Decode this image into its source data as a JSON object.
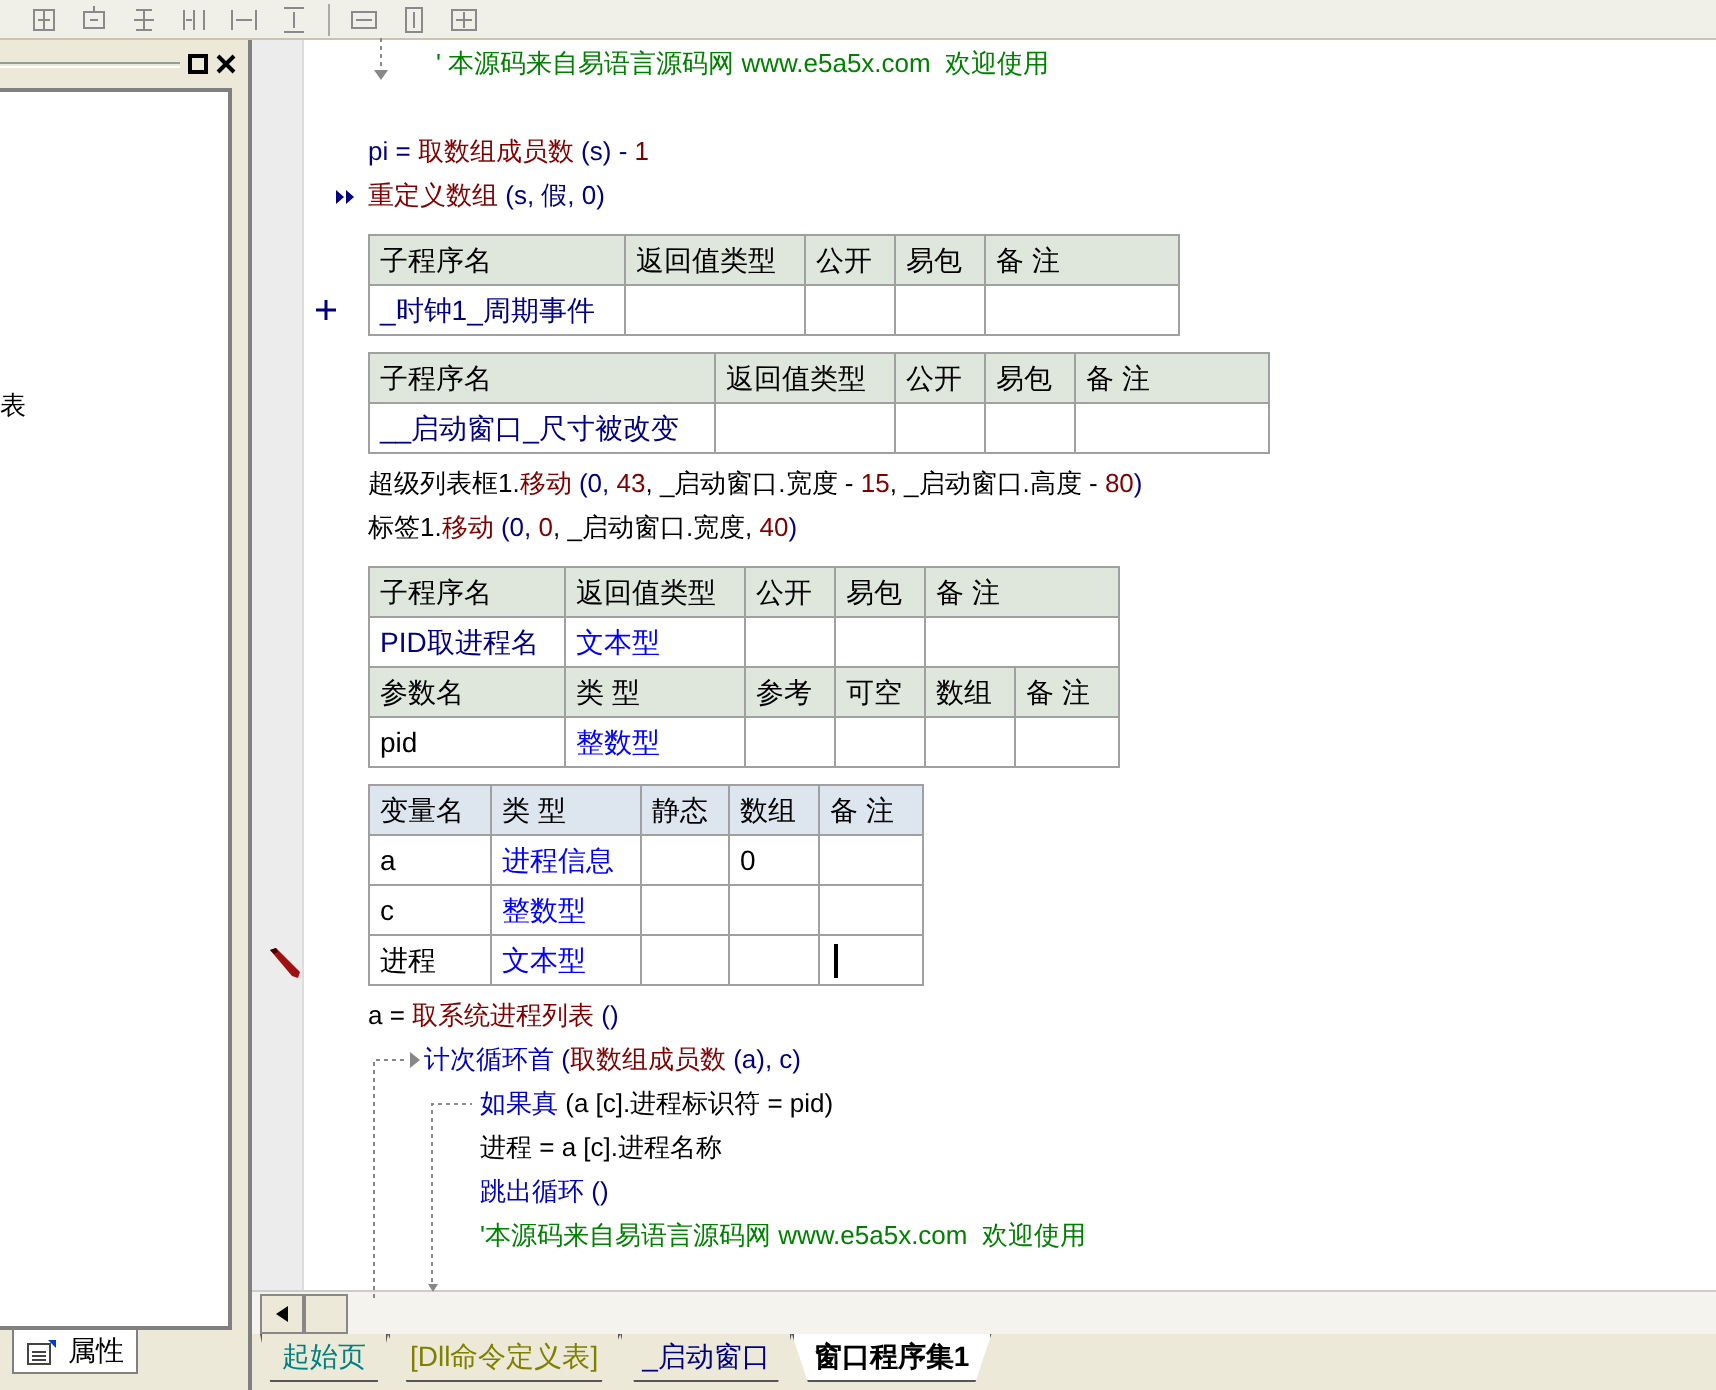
{
  "left_panel": {
    "items": [
      "表"
    ],
    "tabs": [
      {
        "label": "属性",
        "selected": true
      }
    ]
  },
  "code": [
    {
      "kind": "loop_end",
      "segments": [
        {
          "text": "' 本源码来自易语言源码网 www.e5a5x.com  欢迎使用",
          "color": "#008000"
        }
      ]
    },
    {
      "kind": "line",
      "segments": [
        {
          "text": "pi = ",
          "color": "#000080"
        },
        {
          "text": "取数组成员数",
          "color": "#800000"
        },
        {
          "text": " (s) - ",
          "color": "#000080"
        },
        {
          "text": "1",
          "color": "#800000"
        }
      ]
    },
    {
      "kind": "line",
      "marker": true,
      "segments": [
        {
          "text": "重定义数组",
          "color": "#800000"
        },
        {
          "text": " (s, 假, 0)",
          "color": "#000080"
        }
      ]
    },
    {
      "kind": "table",
      "expandable": true,
      "rows": [
        {
          "kind": "header",
          "cells": [
            {
              "text": "子程序名"
            },
            {
              "text": "返回值类型"
            },
            {
              "text": "公开"
            },
            {
              "text": "易包"
            },
            {
              "text": "备 注"
            }
          ]
        },
        {
          "kind": "row",
          "cells": [
            {
              "text": "_时钟1_周期事件",
              "color": "#000080"
            },
            {},
            {},
            {},
            {}
          ]
        }
      ]
    },
    {
      "kind": "table",
      "rows": [
        {
          "kind": "header",
          "cells": [
            {
              "text": "子程序名"
            },
            {
              "text": "返回值类型"
            },
            {
              "text": "公开"
            },
            {
              "text": "易包"
            },
            {
              "text": "备 注"
            }
          ]
        },
        {
          "kind": "row",
          "cells": [
            {
              "text": "__启动窗口_尺寸被改变",
              "color": "#000080"
            },
            {},
            {},
            {},
            {}
          ]
        }
      ]
    },
    {
      "kind": "line",
      "segments": [
        {
          "text": "超级列表框1.",
          "color": "#000000"
        },
        {
          "text": "移动",
          "color": "#800000"
        },
        {
          "text": " (0, ",
          "color": "#000080"
        },
        {
          "text": "43",
          "color": "#800000"
        },
        {
          "text": ", _启动窗口.宽度 - ",
          "color": "#000000"
        },
        {
          "text": "15",
          "color": "#800000"
        },
        {
          "text": ", _启动窗口.高度 - ",
          "color": "#000000"
        },
        {
          "text": "80",
          "color": "#800000"
        },
        {
          "text": ")",
          "color": "#000080"
        }
      ]
    },
    {
      "kind": "line",
      "segments": [
        {
          "text": "标签1.",
          "color": "#000000"
        },
        {
          "text": "移动",
          "color": "#800000"
        },
        {
          "text": " (0, ",
          "color": "#000080"
        },
        {
          "text": "0",
          "color": "#800000"
        },
        {
          "text": ", _启动窗口.宽度, ",
          "color": "#000000"
        },
        {
          "text": "40",
          "color": "#800000"
        },
        {
          "text": ")",
          "color": "#000080"
        }
      ]
    },
    {
      "kind": "table",
      "rows": [
        {
          "kind": "header",
          "cells": [
            {
              "text": "子程序名"
            },
            {
              "text": "返回值类型"
            },
            {
              "text": "公开"
            },
            {
              "text": "易包"
            },
            {
              "text": "备 注"
            }
          ]
        },
        {
          "kind": "row",
          "cells": [
            {
              "text": "PID取进程名",
              "color": "#000080"
            },
            {
              "text": "文本型",
              "color": "#0000ff"
            },
            {},
            {},
            {}
          ]
        },
        {
          "kind": "header",
          "cells": [
            {
              "text": "参数名"
            },
            {
              "text": "类 型"
            },
            {
              "text": "参考"
            },
            {
              "text": "可空"
            },
            {
              "text": "数组"
            },
            {
              "text": "备 注"
            }
          ]
        },
        {
          "kind": "row",
          "cells": [
            {
              "text": "pid"
            },
            {
              "text": "整数型",
              "color": "#0000ff"
            },
            {},
            {},
            {},
            {}
          ]
        }
      ]
    },
    {
      "kind": "table",
      "rows": [
        {
          "kind": "var_header",
          "cells": [
            {
              "text": "变量名"
            },
            {
              "text": "类 型"
            },
            {
              "text": "静态"
            },
            {
              "text": "数组"
            },
            {
              "text": "备 注"
            }
          ]
        },
        {
          "kind": "row",
          "cells": [
            {
              "text": "a"
            },
            {
              "text": "进程信息",
              "color": "#0000ff"
            },
            {},
            {
              "text": "0"
            },
            {}
          ]
        },
        {
          "kind": "row",
          "cells": [
            {
              "text": "c"
            },
            {
              "text": "整数型",
              "color": "#0000ff"
            },
            {},
            {},
            {}
          ]
        },
        {
          "kind": "row",
          "editing": true,
          "cells": [
            {
              "text": "进程"
            },
            {
              "text": "文本型",
              "color": "#0000ff"
            },
            {},
            {},
            {
              "cursor": true
            }
          ]
        }
      ]
    },
    {
      "kind": "line",
      "segments": [
        {
          "text": "a = ",
          "color": "#000000"
        },
        {
          "text": "取系统进程列表",
          "color": "#800000"
        },
        {
          "text": " ()",
          "color": "#000080"
        }
      ]
    },
    {
      "kind": "loop",
      "segments": [
        {
          "text": "计次循环首",
          "color": "#0000c0"
        },
        {
          "text": " (",
          "color": "#000080"
        },
        {
          "text": "取数组成员数",
          "color": "#800000"
        },
        {
          "text": " (a), c)",
          "color": "#000080"
        }
      ],
      "children": [
        {
          "kind": "line",
          "segments": [
            {
              "text": "如果真",
              "color": "#0000c0"
            },
            {
              "text": " (a [c].进程标识符 = pid)",
              "color": "#000000"
            }
          ]
        },
        {
          "kind": "line",
          "segments": [
            {
              "text": "进程 = a [c].进程名称",
              "color": "#000000"
            }
          ]
        },
        {
          "kind": "line",
          "segments": [
            {
              "text": "跳出循环",
              "color": "#0000c0"
            },
            {
              "text": " ()",
              "color": "#000080"
            }
          ]
        },
        {
          "kind": "line",
          "segments": [
            {
              "text": "'本源码来自易语言源码网 www.e5a5x.com  欢迎使用",
              "color": "#008000"
            }
          ]
        }
      ]
    }
  ],
  "tabs": [
    {
      "label": "起始页",
      "color": "#008080",
      "selected": false
    },
    {
      "label": "[Dll命令定义表]",
      "color": "#808000",
      "selected": false
    },
    {
      "label": "_启动窗口",
      "color": "#000080",
      "selected": false
    },
    {
      "label": "窗口程序集1",
      "color": "#000000",
      "selected": true
    }
  ]
}
